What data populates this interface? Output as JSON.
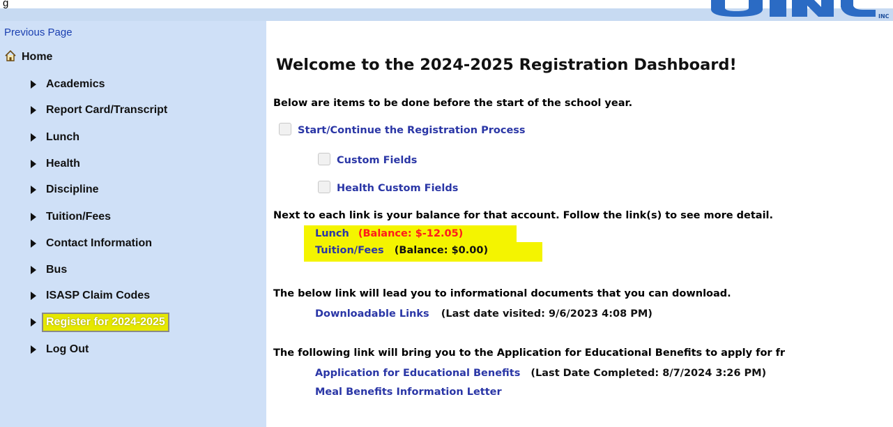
{
  "header": {
    "cut_text": "g",
    "logo_suffix": "INC"
  },
  "sidebar": {
    "previous_page": "Previous Page",
    "home": "Home",
    "items": [
      {
        "label": "Academics"
      },
      {
        "label": "Report Card/Transcript"
      },
      {
        "label": "Lunch"
      },
      {
        "label": "Health"
      },
      {
        "label": "Discipline"
      },
      {
        "label": "Tuition/Fees"
      },
      {
        "label": "Contact Information"
      },
      {
        "label": "Bus"
      },
      {
        "label": "ISASP Claim Codes"
      },
      {
        "label": "Register for 2024-2025"
      },
      {
        "label": "Log Out"
      }
    ]
  },
  "main": {
    "title": "Welcome to the 2024-2025 Registration Dashboard!",
    "intro": "Below are items to be done before the start of the school year.",
    "tasks": {
      "registration": "Start/Continue the Registration Process",
      "custom_fields": "Custom Fields",
      "health_custom_fields": "Health Custom Fields"
    },
    "balance_intro": "Next to each link is your balance for that account. Follow the link(s) to see more detail.",
    "balances": {
      "lunch_label": "Lunch",
      "lunch_balance": "(Balance: $-12.05)",
      "tuition_label": "Tuition/Fees",
      "tuition_balance": "(Balance: $0.00)"
    },
    "documents_intro": "The below link will lead you to informational documents that you can download.",
    "downloadable_links": "Downloadable Links",
    "downloadable_visited": "(Last date visited: 9/6/2023 4:08 PM)",
    "benefits_intro": "The following link will bring you to the Application for Educational Benefits to apply for fr",
    "benefits_link": "Application for Educational Benefits",
    "benefits_completed": "(Last Date Completed: 8/7/2024 3:26 PM)",
    "meal_letter": "Meal Benefits Information Letter"
  },
  "colors": {
    "sidebar_bg": "#cfe0f7",
    "link_blue": "#2a36a6",
    "highlight": "#f4f400",
    "negative_balance": "#ff1b1b"
  }
}
